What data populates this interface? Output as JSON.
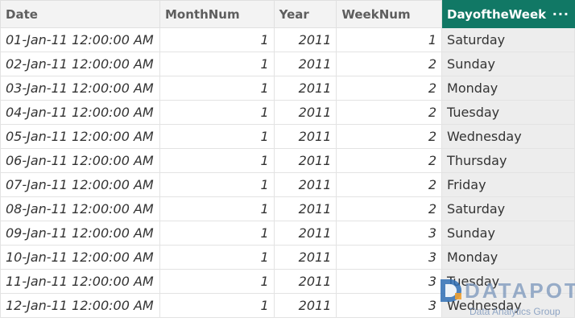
{
  "headers": [
    {
      "label": "Date"
    },
    {
      "label": "MonthNum"
    },
    {
      "label": "Year"
    },
    {
      "label": "WeekNum"
    },
    {
      "label": "DayoftheWeek",
      "menu": "···"
    }
  ],
  "rows": [
    {
      "date": "01-Jan-11 12:00:00 AM",
      "month": "1",
      "year": "2011",
      "week": "1",
      "day": "Saturday"
    },
    {
      "date": "02-Jan-11 12:00:00 AM",
      "month": "1",
      "year": "2011",
      "week": "2",
      "day": "Sunday"
    },
    {
      "date": "03-Jan-11 12:00:00 AM",
      "month": "1",
      "year": "2011",
      "week": "2",
      "day": "Monday"
    },
    {
      "date": "04-Jan-11 12:00:00 AM",
      "month": "1",
      "year": "2011",
      "week": "2",
      "day": "Tuesday"
    },
    {
      "date": "05-Jan-11 12:00:00 AM",
      "month": "1",
      "year": "2011",
      "week": "2",
      "day": "Wednesday"
    },
    {
      "date": "06-Jan-11 12:00:00 AM",
      "month": "1",
      "year": "2011",
      "week": "2",
      "day": "Thursday"
    },
    {
      "date": "07-Jan-11 12:00:00 AM",
      "month": "1",
      "year": "2011",
      "week": "2",
      "day": "Friday"
    },
    {
      "date": "08-Jan-11 12:00:00 AM",
      "month": "1",
      "year": "2011",
      "week": "2",
      "day": "Saturday"
    },
    {
      "date": "09-Jan-11 12:00:00 AM",
      "month": "1",
      "year": "2011",
      "week": "3",
      "day": "Sunday"
    },
    {
      "date": "10-Jan-11 12:00:00 AM",
      "month": "1",
      "year": "2011",
      "week": "3",
      "day": "Monday"
    },
    {
      "date": "11-Jan-11 12:00:00 AM",
      "month": "1",
      "year": "2011",
      "week": "3",
      "day": "Tuesday"
    },
    {
      "date": "12-Jan-11 12:00:00 AM",
      "month": "1",
      "year": "2011",
      "week": "3",
      "day": "Wednesday"
    }
  ],
  "watermark": {
    "brand": "DATAPOT",
    "tagline": "Data Analytics Group"
  },
  "colors": {
    "active_header": "#117865",
    "selected_column": "#ededed",
    "header_bg": "#f3f3f3",
    "watermark": "#7894ba"
  }
}
